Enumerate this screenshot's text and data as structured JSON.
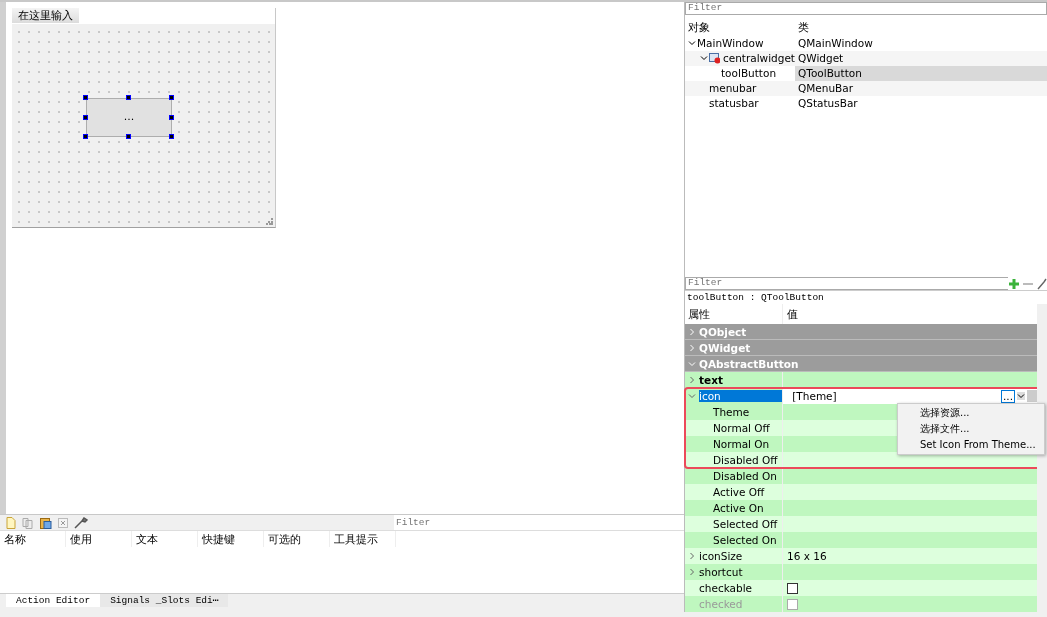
{
  "form": {
    "menu_placeholder": "在这里输入",
    "tool_button": "..."
  },
  "action_editor": {
    "filter": {
      "placeholder": "Filter"
    },
    "columns": [
      "名称",
      "使用",
      "文本",
      "快捷键",
      "可选的",
      "工具提示"
    ],
    "tabs": [
      {
        "label": "Action Editor",
        "selected": true
      },
      {
        "label": "Signals _Slots Edi⋯",
        "selected": false
      }
    ]
  },
  "object_inspector": {
    "filter": {
      "placeholder": "Filter"
    },
    "columns": [
      "对象",
      "类"
    ],
    "tree": [
      {
        "name": "MainWindow",
        "class": "QMainWindow",
        "expanded": true,
        "selected": false,
        "children": [
          {
            "name": "centralwidget",
            "class": "QWidget",
            "expanded": true,
            "selected": false,
            "children": [
              {
                "name": "toolButton",
                "class": "QToolButton",
                "selected": true
              }
            ]
          },
          {
            "name": "menubar",
            "class": "QMenuBar",
            "selected": false
          },
          {
            "name": "statusbar",
            "class": "QStatusBar",
            "selected": false
          }
        ]
      }
    ]
  },
  "property_editor": {
    "filter": {
      "placeholder": "Filter"
    },
    "object_label": "toolButton : QToolButton",
    "columns": [
      "属性",
      "值"
    ],
    "rows": [
      {
        "kind": "group",
        "name": "QObject",
        "expanded": false
      },
      {
        "kind": "group",
        "name": "QWidget",
        "expanded": false
      },
      {
        "kind": "group",
        "name": "QAbstractButton",
        "expanded": true
      },
      {
        "kind": "property",
        "name": "text",
        "expanded": false,
        "modified": true
      },
      {
        "kind": "property",
        "name": "icon",
        "expanded": true,
        "selected": true,
        "value": "[Theme]",
        "button": "..."
      },
      {
        "kind": "sub",
        "name": "Theme"
      },
      {
        "kind": "sub",
        "name": "Normal Off"
      },
      {
        "kind": "sub",
        "name": "Normal On"
      },
      {
        "kind": "sub",
        "name": "Disabled Off"
      },
      {
        "kind": "sub",
        "name": "Disabled On"
      },
      {
        "kind": "sub",
        "name": "Active Off"
      },
      {
        "kind": "sub",
        "name": "Active On"
      },
      {
        "kind": "sub",
        "name": "Selected Off"
      },
      {
        "kind": "sub",
        "name": "Selected On"
      },
      {
        "kind": "property",
        "name": "iconSize",
        "expanded": false,
        "value": "16 x 16"
      },
      {
        "kind": "property",
        "name": "shortcut",
        "expanded": false
      },
      {
        "kind": "checkbox",
        "name": "checkable",
        "checked": false,
        "disabled": false
      },
      {
        "kind": "checkbox",
        "name": "checked",
        "checked": false,
        "disabled": true
      }
    ],
    "menu": [
      "选择资源...",
      "选择文件...",
      "Set Icon From Theme..."
    ]
  }
}
